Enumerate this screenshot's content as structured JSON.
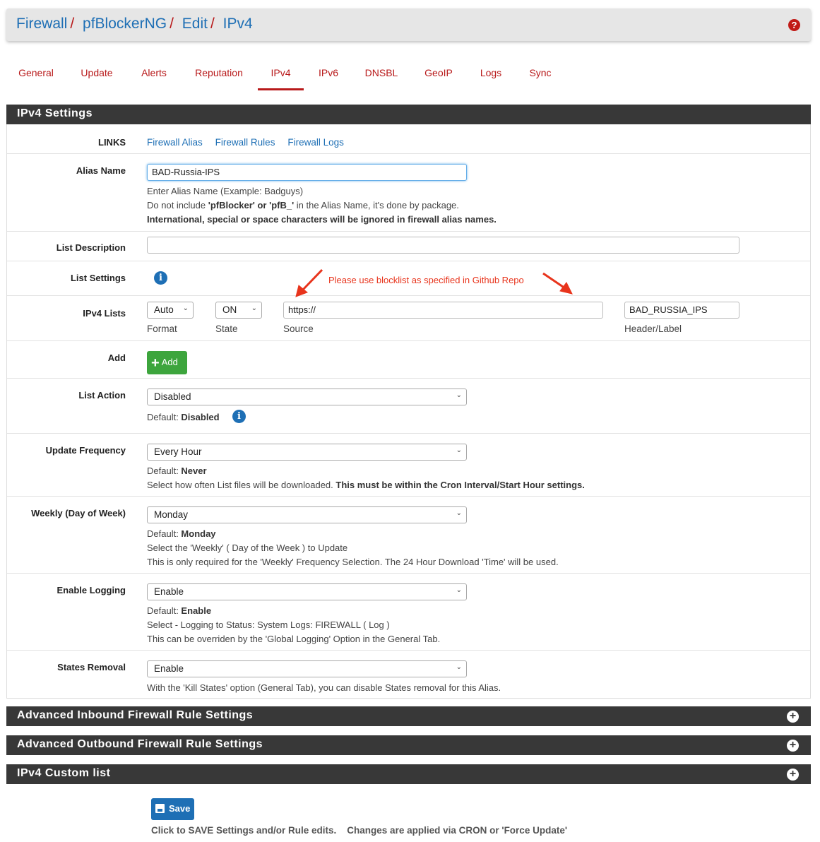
{
  "breadcrumb": [
    "Firewall",
    "pfBlockerNG",
    "Edit",
    "IPv4"
  ],
  "help_icon": "question-circle-icon",
  "tabs": [
    "General",
    "Update",
    "Alerts",
    "Reputation",
    "IPv4",
    "IPv6",
    "DNSBL",
    "GeoIP",
    "Logs",
    "Sync"
  ],
  "active_tab": "IPv4",
  "settings": {
    "heading": "IPv4 Settings",
    "links": {
      "label": "LINKS",
      "items": [
        "Firewall Alias",
        "Firewall Rules",
        "Firewall Logs"
      ]
    },
    "alias_name": {
      "label": "Alias Name",
      "value": "BAD-Russia-IPS",
      "help1": "Enter Alias Name (Example: Badguys)",
      "help2_pre": "Do not include ",
      "help2_bold": "'pfBlocker' or 'pfB_'",
      "help2_post": " in the Alias Name, it's done by package.",
      "help3": "International, special or space characters will be ignored in firewall alias names."
    },
    "list_description": {
      "label": "List Description",
      "value": ""
    },
    "list_settings": {
      "label": "List Settings"
    },
    "annotation": "Please use blocklist as specified in Github Repo",
    "ipv4_lists": {
      "label": "IPv4 Lists",
      "format": "Auto",
      "state": "ON",
      "source": "https://",
      "header": "BAD_RUSSIA_IPS",
      "format_label": "Format",
      "state_label": "State",
      "source_label": "Source",
      "header_label": "Header/Label"
    },
    "add": {
      "label": "Add",
      "button": "Add"
    },
    "list_action": {
      "label": "List Action",
      "value": "Disabled",
      "default_pre": "Default: ",
      "default_val": "Disabled"
    },
    "update_frequency": {
      "label": "Update Frequency",
      "value": "Every Hour",
      "default_pre": "Default: ",
      "default_val": "Never",
      "help_pre": "Select how often List files will be downloaded. ",
      "help_bold": "This must be within the Cron Interval/Start Hour settings."
    },
    "weekly": {
      "label": "Weekly (Day of Week)",
      "value": "Monday",
      "default_pre": "Default: ",
      "default_val": "Monday",
      "help1": "Select the 'Weekly' ( Day of the Week ) to Update",
      "help2": "This is only required for the 'Weekly' Frequency Selection. The 24 Hour Download 'Time' will be used."
    },
    "logging": {
      "label": "Enable Logging",
      "value": "Enable",
      "default_pre": "Default: ",
      "default_val": "Enable",
      "help1": "Select - Logging to Status: System Logs: FIREWALL ( Log )",
      "help2": "This can be overriden by the 'Global Logging' Option in the General Tab."
    },
    "states_removal": {
      "label": "States Removal",
      "value": "Enable",
      "help": "With the 'Kill States' option (General Tab), you can disable States removal for this Alias."
    }
  },
  "collapsed_panels": [
    "Advanced Inbound Firewall Rule Settings",
    "Advanced Outbound Firewall Rule Settings",
    "IPv4 Custom list"
  ],
  "save": {
    "button": "Save",
    "note": "Click to SAVE Settings and/or Rule edits.    Changes are applied via CRON or 'Force Update'"
  },
  "colors": {
    "link": "#1e6fb5",
    "tab": "#b8191a",
    "heading_bg": "#383838",
    "add_btn": "#3da53d",
    "annotation": "#e8341c"
  }
}
